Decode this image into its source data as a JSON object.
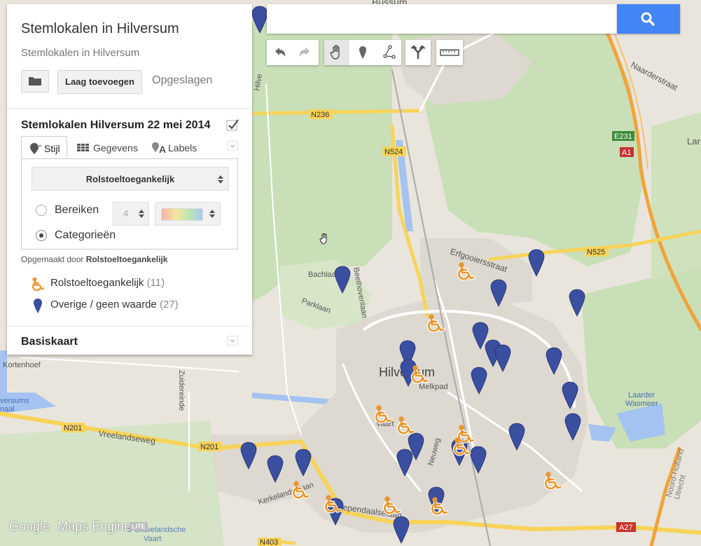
{
  "map": {
    "labels": [
      {
        "id": "bussum",
        "text": "Bussum"
      },
      {
        "id": "naarderstraat",
        "text": "Naarderstraat"
      },
      {
        "id": "n236",
        "text": "N236"
      },
      {
        "id": "n524",
        "text": "N524"
      },
      {
        "id": "e231",
        "text": "E231"
      },
      {
        "id": "a1",
        "text": "A1"
      },
      {
        "id": "n525",
        "text": "N525"
      },
      {
        "id": "erfgooiersstraat",
        "text": "Erfgooiersstraat"
      },
      {
        "id": "bachlaan",
        "text": "Bachlaan"
      },
      {
        "id": "beethovenlaan",
        "text": "Beethovenlaan"
      },
      {
        "id": "parklaan",
        "text": "Parklaan"
      },
      {
        "id": "hilversum",
        "text": "Hilversum"
      },
      {
        "id": "melkpad",
        "text": "Melkpad"
      },
      {
        "id": "kortenhoef",
        "text": "Kortenhoef"
      },
      {
        "id": "zuidereinde",
        "text": "Zuidereinde"
      },
      {
        "id": "n201a",
        "text": "N201"
      },
      {
        "id": "n201b",
        "text": "N201"
      },
      {
        "id": "vreelandseweg",
        "text": "Vreelandseweg"
      },
      {
        "id": "laarder",
        "text": "Laarder\nWasmeer"
      },
      {
        "id": "noordholland",
        "text": "Noord-Holland\nUtrecht"
      },
      {
        "id": "a27",
        "text": "A27"
      },
      {
        "id": "n403",
        "text": "N403"
      },
      {
        "id": "diependaalselaan",
        "text": "Diependaalselaan"
      },
      {
        "id": "kerkelandenlaan",
        "text": "Kerkelandenlaan"
      },
      {
        "id": "neuweg",
        "text": "Neuweg"
      },
      {
        "id": "gravelandsche",
        "text": "'s-Gravelandsche\nVaart"
      },
      {
        "id": "versums",
        "text": "versums\nnaal"
      },
      {
        "id": "vaart",
        "text": "Vaart"
      },
      {
        "id": "hilversum_top",
        "text": "Hilve"
      },
      {
        "id": "lar",
        "text": "Lar"
      }
    ],
    "wheelchair_markers": [
      [
        666,
        386
      ],
      [
        623,
        460
      ],
      [
        600,
        533
      ],
      [
        548,
        590
      ],
      [
        580,
        606
      ],
      [
        666,
        618
      ],
      [
        660,
        636
      ],
      [
        790,
        685
      ],
      [
        430,
        698
      ],
      [
        476,
        718
      ],
      [
        560,
        720
      ],
      [
        628,
        721
      ]
    ],
    "other_markers": [
      [
        371,
        29
      ],
      [
        489,
        400
      ],
      [
        766,
        376
      ],
      [
        712,
        419
      ],
      [
        824,
        433
      ],
      [
        686,
        480
      ],
      [
        704,
        505
      ],
      [
        718,
        512
      ],
      [
        791,
        516
      ],
      [
        582,
        506
      ],
      [
        583,
        533
      ],
      [
        684,
        544
      ],
      [
        814,
        565
      ],
      [
        818,
        610
      ],
      [
        738,
        624
      ],
      [
        594,
        638
      ],
      [
        656,
        646
      ],
      [
        578,
        661
      ],
      [
        683,
        657
      ],
      [
        355,
        651
      ],
      [
        393,
        670
      ],
      [
        433,
        661
      ],
      [
        623,
        715
      ],
      [
        479,
        731
      ],
      [
        573,
        757
      ]
    ]
  },
  "panel": {
    "title": "Stemlokalen in Hilversum",
    "subtitle": "Stemlokalen in Hilversum",
    "add_layer_label": "Laag toevoegen",
    "saved_label": "Opgeslagen",
    "layer": {
      "name": "Stemlokalen Hilversum 22 mei 2014",
      "tabs": [
        "Stijl",
        "Gegevens",
        "Labels"
      ],
      "style_by": "Rolstoeltoegankelijk",
      "ranges_label": "Bereiken",
      "ranges_count": "4",
      "categories_label": "Categorieën",
      "created_by_prefix": "Opgemaakt door",
      "created_by_field": "Rolstoeltoegankelijk",
      "legend": [
        {
          "label": "Rolstoeltoegankelijk",
          "count": "(11)"
        },
        {
          "label": "Overige / geen waarde",
          "count": "(27)"
        }
      ]
    },
    "basemap_label": "Basiskaart"
  },
  "attribution": {
    "google": "Google",
    "product": "Maps Engine",
    "badge": "LITE"
  },
  "colors": {
    "accent": "#4285f4",
    "marker_blue": "#3a4fa0",
    "marker_orange": "#e8962c"
  }
}
